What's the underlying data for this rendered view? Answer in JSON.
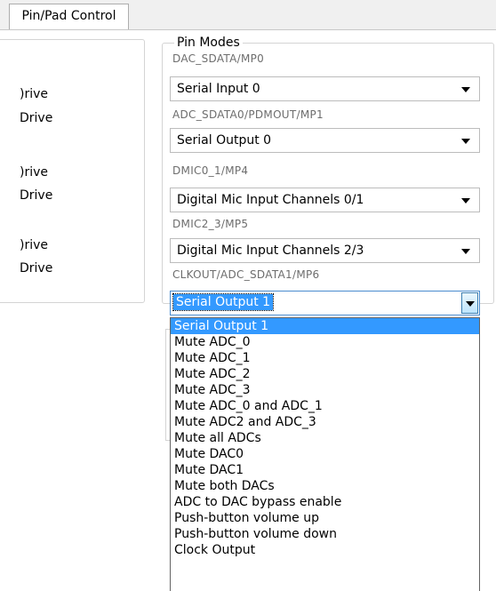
{
  "tabs": {
    "active": "Pin/Pad Control"
  },
  "left_panel": {
    "labels": [
      ")rive",
      "Drive",
      ")rive",
      "Drive",
      ")rive",
      "Drive"
    ]
  },
  "pin_modes": {
    "legend": "Pin Modes",
    "rows": [
      {
        "label": "DAC_SDATA/MP0",
        "value": "Serial Input 0"
      },
      {
        "label": "ADC_SDATA0/PDMOUT/MP1",
        "value": "Serial Output 0"
      },
      {
        "label": "DMIC0_1/MP4",
        "value": "Digital Mic Input Channels 0/1"
      },
      {
        "label": "DMIC2_3/MP5",
        "value": "Digital Mic Input Channels 2/3"
      },
      {
        "label": "CLKOUT/ADC_SDATA1/MP6",
        "value": "Serial Output 1"
      }
    ]
  },
  "dropdown": {
    "selected_index": 0,
    "options": [
      "Serial Output 1",
      "Mute ADC_0",
      "Mute ADC_1",
      "Mute ADC_2",
      "Mute ADC_3",
      "Mute ADC_0 and ADC_1",
      "Mute ADC2 and ADC_3",
      "Mute all ADCs",
      "Mute DAC0",
      "Mute DAC1",
      "Mute both DACs",
      "ADC to DAC bypass enable",
      "Push-button volume up",
      "Push-button volume down",
      "Clock Output"
    ]
  },
  "colors": {
    "selection": "#3399ff",
    "label_gray": "#6d6d6d"
  }
}
